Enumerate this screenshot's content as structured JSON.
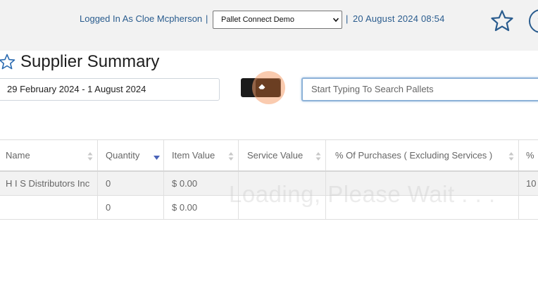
{
  "header": {
    "login_text": "Logged In As Cloe Mcpherson",
    "separator_1": "|",
    "site_select": {
      "value": "Pallet Connect Demo"
    },
    "separator_2": "|",
    "datetime": "20 August 2024 08:54",
    "help_label": "?"
  },
  "page": {
    "title": "Supplier Summary"
  },
  "filters": {
    "date_range": "29 February 2024 - 1 August 2024",
    "search_placeholder": "Start Typing To Search Pallets"
  },
  "table": {
    "columns": [
      {
        "label": "Name"
      },
      {
        "label": "Quantity"
      },
      {
        "label": "Item Value"
      },
      {
        "label": "Service Value"
      },
      {
        "label": "% Of Purchases ( Excluding Services )"
      },
      {
        "label": "%"
      }
    ],
    "sorted_column": "Quantity",
    "rows": [
      {
        "name": "H I S Distributors Inc",
        "quantity": "0",
        "item_value": "$ 0.00",
        "service_value": "",
        "pct": "",
        "pct2": "10"
      },
      {
        "name": "",
        "quantity": "0",
        "item_value": "$ 0.00",
        "service_value": "",
        "pct": "",
        "pct2": ""
      }
    ]
  },
  "overlay": {
    "loading_text": "Loading, Please Wait . . ."
  },
  "colors": {
    "accent": "#2a5c8e",
    "button_dark": "#1b1b1b",
    "click_highlight": "#f5a06e"
  },
  "icons": {
    "favorite_top": "star-outline-icon",
    "help": "help-circle-icon",
    "title_favorite": "star-outline-icon",
    "clear": "eraser-icon"
  }
}
